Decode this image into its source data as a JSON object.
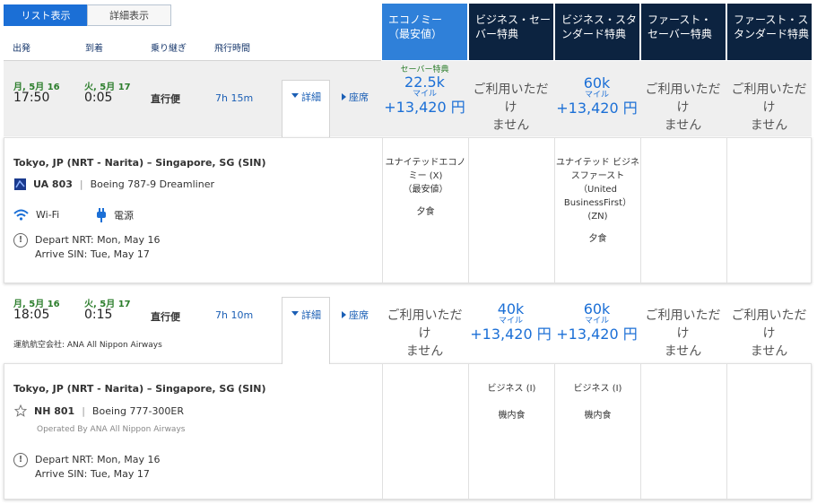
{
  "view_toggle": {
    "list": "リスト表示",
    "detail": "詳細表示"
  },
  "columns": {
    "depart": "出発",
    "arrive": "到着",
    "connections": "乗り継ぎ",
    "duration": "飛行時間"
  },
  "fare_headers": [
    {
      "line1": "エコノミー",
      "line2": "（最安値）"
    },
    {
      "line1": "ビジネス・セー",
      "line2": "バー特典"
    },
    {
      "line1": "ビジネス・スタ",
      "line2": "ンダード特典"
    },
    {
      "line1": "ファースト・",
      "line2": "セーバー特典"
    },
    {
      "line1": "ファースト・ス",
      "line2": "タンダード特典"
    }
  ],
  "na_text": {
    "line1": "ご利用いただけ",
    "line2": "ません"
  },
  "tabs": {
    "detail": "詳細",
    "seats": "座席"
  },
  "flights": [
    {
      "depart_date": "月, 5月 16",
      "depart_time": "17:50",
      "arrive_date": "火, 5月 17",
      "arrive_time": "0:05",
      "stops": "直行便",
      "duration": "7h 15m",
      "fares": [
        {
          "label": "セーバー特典",
          "miles": "22.5k",
          "unit": "マイル",
          "price": "+13,420 円"
        },
        null,
        {
          "label": "",
          "miles": "60k",
          "unit": "マイル",
          "price": "+13,420 円"
        },
        null,
        null
      ],
      "detail": {
        "route": "Tokyo, JP (NRT - Narita) –  Singapore, SG (SIN)",
        "flight_number": "UA 803",
        "aircraft": "Boeing 787-9 Dreamliner",
        "wifi": "Wi-Fi",
        "power": "電源",
        "depart_line": "Depart NRT: Mon, May 16",
        "arrive_line": "Arrive SIN: Tue, May 17",
        "cabins": [
          [
            "ユナイテッドエコノ",
            "ミー (X)",
            "（最安値）",
            "",
            "夕食"
          ],
          [],
          [
            "ユナイテッド ビジネ",
            "スファースト",
            "（United",
            "BusinessFirst）",
            "(ZN)",
            "",
            "夕食"
          ],
          [],
          []
        ]
      }
    },
    {
      "depart_date": "月, 5月 16",
      "depart_time": "18:05",
      "arrive_date": "火, 5月 17",
      "arrive_time": "0:15",
      "stops": "直行便",
      "duration": "7h 10m",
      "operated": "運航航空会社: ANA All Nippon Airways",
      "fares": [
        null,
        {
          "label": "",
          "miles": "40k",
          "unit": "マイル",
          "price": "+13,420 円"
        },
        {
          "label": "",
          "miles": "60k",
          "unit": "マイル",
          "price": "+13,420 円"
        },
        null,
        null
      ],
      "detail": {
        "route": "Tokyo, JP (NRT - Narita) –  Singapore, SG (SIN)",
        "flight_number": "NH 801",
        "aircraft": "Boeing 777-300ER",
        "operated_by": "Operated By ANA All Nippon Airways",
        "depart_line": "Depart NRT: Mon, May 16",
        "arrive_line": "Arrive SIN: Tue, May 17",
        "cabins": [
          [],
          [
            "ビジネス (I)",
            "",
            "機内食"
          ],
          [
            "ビジネス (I)",
            "",
            "機内食"
          ],
          [],
          []
        ]
      }
    }
  ],
  "colors": {
    "economy_header": "#2f80d9",
    "premium_header": "#0c2340",
    "price": "#1b6fd6",
    "date": "#2b7d2b"
  }
}
